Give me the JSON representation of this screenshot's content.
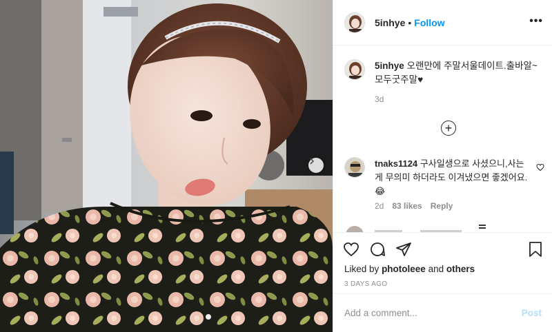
{
  "post": {
    "username": "5inhye",
    "follow_label": "Follow",
    "dot": "•",
    "more_label": "•••"
  },
  "caption": {
    "username": "5inhye",
    "text": "오랜만에 주말서울데이트.출바알~모두굿주말♥",
    "time": "3d"
  },
  "comment": {
    "username": "tnaks1124",
    "text": "구사일생으로 사셨으니,사는게 무의미 하더라도 이겨냈으면 좋겠어요.",
    "emoji": "😂",
    "time": "2d",
    "likes": "83 likes",
    "reply": "Reply"
  },
  "likes": {
    "prefix": "Liked by",
    "user": "photoleee",
    "and": "and",
    "others": "others"
  },
  "timestamp": "3 DAYS AGO",
  "add_comment": {
    "placeholder": "Add a comment...",
    "post_label": "Post"
  },
  "icons": {
    "like": "heart-icon",
    "comment": "comment-icon",
    "share": "share-icon",
    "save": "bookmark-icon",
    "load_more": "plus-circle-icon",
    "next": "chevron-right-icon"
  },
  "colors": {
    "accent": "#0095f6",
    "post_disabled": "#b2dffc",
    "muted": "#8e8e8e"
  }
}
